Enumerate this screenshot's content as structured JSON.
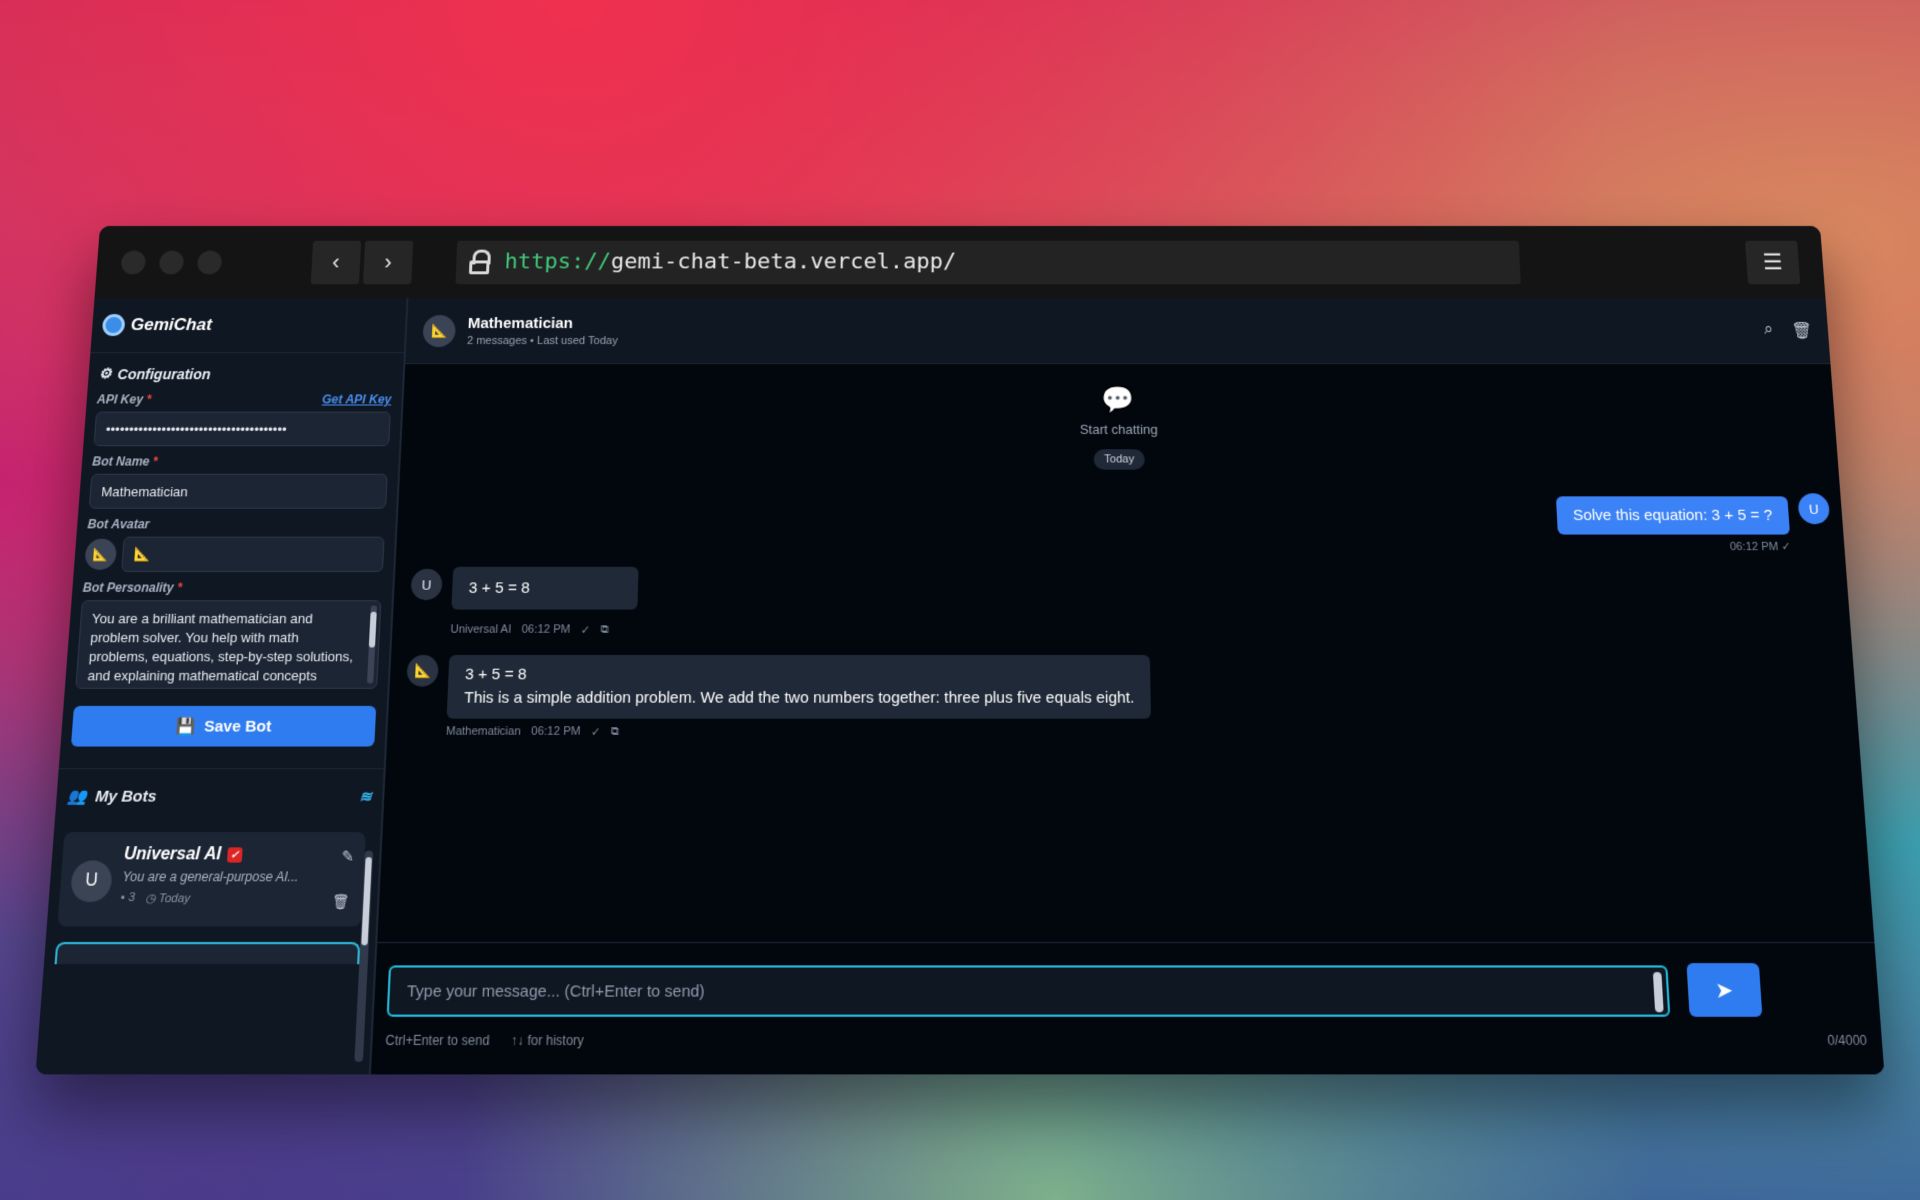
{
  "browser": {
    "url_scheme": "https://",
    "url_host": "gemi-chat-beta.vercel.app/",
    "back_icon": "chevron-left-icon",
    "forward_icon": "chevron-right-icon",
    "settings_icon": "sliders-icon"
  },
  "sidebar": {
    "brand": "GemiChat",
    "config_title": "Configuration",
    "api_key_label": "API Key",
    "api_key_required": "*",
    "get_api_key": "Get API Key",
    "api_key_value": "•••••••••••••••••••••••••••••••••••••••",
    "bot_name_label": "Bot Name",
    "bot_name_required": "*",
    "bot_name_value": "Mathematician",
    "bot_avatar_label": "Bot Avatar",
    "bot_avatar_value": "📐",
    "bot_personality_label": "Bot Personality",
    "bot_personality_required": "*",
    "bot_personality_value": "You are a brilliant mathematician and problem solver. You help with math problems, equations, step-by-step solutions, and explaining mathematical concepts clearly. You excel",
    "save_label": "Save Bot",
    "my_bots_title": "My Bots",
    "bots": [
      {
        "avatar": "U",
        "name": "Universal AI",
        "desc": "You are a general-purpose AI...",
        "count": "3",
        "last_used": "Today"
      }
    ]
  },
  "chat": {
    "bot_avatar": "📐",
    "title": "Mathematician",
    "subtitle": "2 messages • Last used Today",
    "start_label": "Start chatting",
    "date_divider": "Today",
    "messages": [
      {
        "role": "user",
        "avatar": "U",
        "text": "Solve this equation: 3 + 5 = ?",
        "time": "06:12 PM",
        "status": "✓"
      },
      {
        "role": "bot",
        "avatar": "U",
        "text": "3 + 5 = 8",
        "author": "Universal AI",
        "time": "06:12 PM",
        "status": "✓"
      },
      {
        "role": "bot",
        "avatar": "📐",
        "line1": "3 + 5 = 8",
        "line2": "This is a simple addition problem. We add the two numbers together: three plus five equals eight.",
        "author": "Mathematician",
        "time": "06:12 PM",
        "status": "✓"
      }
    ],
    "input_placeholder": "Type your message... (Ctrl+Enter to send)",
    "hint_send": "Ctrl+Enter to send",
    "hint_history": "↑↓ for history",
    "counter": "0/4000"
  },
  "colors": {
    "accent": "#2f7cf0",
    "focus_ring": "#22b8d6",
    "sidebar_bg": "#0f1722",
    "main_bg": "#02060d"
  }
}
